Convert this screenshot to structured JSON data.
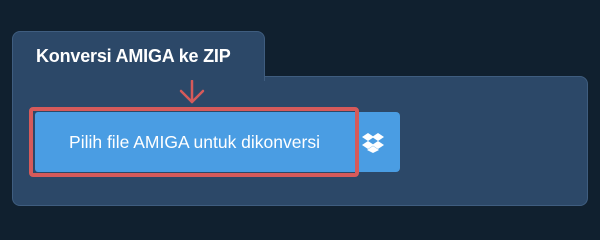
{
  "tab": {
    "title": "Konversi AMIGA ke ZIP"
  },
  "upload": {
    "label": "Pilih file AMIGA untuk dikonversi"
  },
  "icons": {
    "arrow": "arrow-down-icon",
    "dropbox": "dropbox-icon"
  },
  "colors": {
    "background": "#10202f",
    "panel": "#2c4868",
    "button": "#4a9de3",
    "highlight": "#d65a5a"
  }
}
